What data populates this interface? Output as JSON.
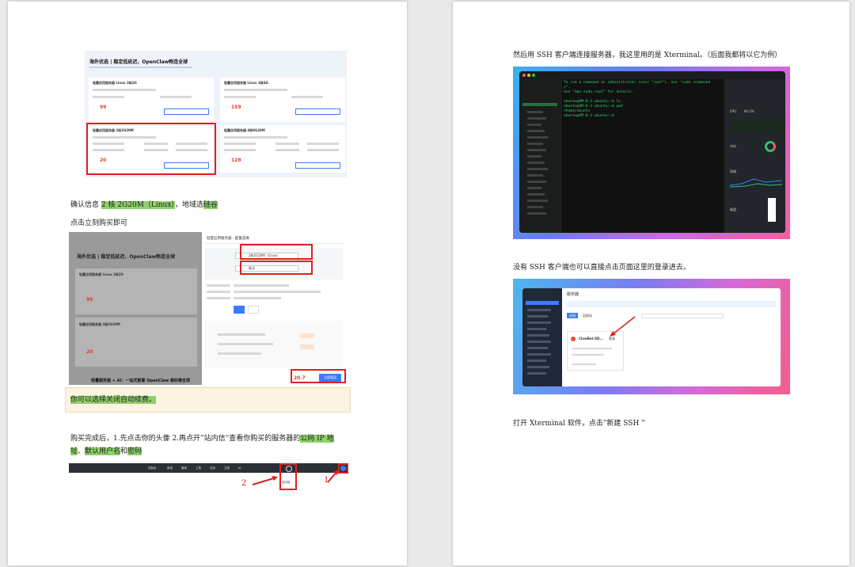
{
  "page1": {
    "shot1": {
      "title": "海外优选 | 稳定低延迟，OpenClaw畅连全球",
      "cards": [
        {
          "name": "轻量应用服务器 Linux 2核2G",
          "price": "99"
        },
        {
          "name": "轻量应用服务器 Linux 2核4G",
          "price": "159"
        },
        {
          "name": "轻量应用服务器 2核2G20M",
          "price": "20"
        },
        {
          "name": "轻量应用服务器 4核8G30M",
          "price": "128"
        }
      ],
      "buy_label": "立即购买"
    },
    "line1": {
      "pre": "确认信息 ",
      "hl1": "2 核 2G20M（Linux）",
      "mid": "，地域选",
      "hl2": "硅谷"
    },
    "line2": "点击立刻购买即可",
    "shot2": {
      "left_title": "海外优选 | 稳定低延迟，OpenClaw畅连全球",
      "card_a": "轻量应用服务器 Linux 2核2G",
      "card_b": "轻量应用服务器 2核2G20M",
      "price_a": "99",
      "price_b": "20",
      "bottom_text": "轻量服务器 + AI：一站式部署 OpenClaw 做好模全球",
      "panel_title": "轻量应用服务器 · 配置选择",
      "sel_os": "2核2G20M（Linux）",
      "sel_region": "硅谷",
      "total_price": "20.7",
      "buy_btn": "立即购买"
    },
    "note": "你可以选择关闭自动续费。",
    "line3": {
      "pre": "购买完成后，1.先点击你的头像 2.再点开”站内信“查看你购买的服务器的",
      "hl1": "公网 IP 地"
    },
    "line4": {
      "hl1": "址",
      "s1": "、",
      "hl2": "默认用户名",
      "s2": "和",
      "hl3": "密码"
    },
    "shot3": {
      "label_2": "2",
      "label_1": "1",
      "msg": "站内信",
      "menu": [
        "控制台",
        "费用",
        "备案",
        "工具",
        "支持",
        "文档",
        "AI"
      ]
    }
  },
  "page2": {
    "line1": "然后用 SSH 客户端连接服务器，我这里用的是 Xterminal。（后面我都将以它为例）",
    "terminal": {
      "lines": [
        "To run a command as administrator (user \"root\"), use \"sudo <command",
        ">\".",
        "See \"man sudo_root\" for details.",
        "",
        "ubuntu@VM-0-2-ubuntu:~$ ls",
        "ubuntu@VM-0-2-ubuntu:~$ pwd",
        "/home/ubuntu",
        "ubuntu@VM-0-2-ubuntu:~$ "
      ],
      "side_cpu": "CPU",
      "side_mem": "内存",
      "side_net": "网络",
      "side_disk": "磁盘",
      "cpu_val": "84.2%"
    },
    "line2": "没有 SSH 客户端也可以直接点击页面这里的登录进去。",
    "console": {
      "title": "服务器",
      "instance": "ClawBot-SD...",
      "login": "登录",
      "tab1": "实例",
      "tab2": "回收站"
    },
    "line3": "打开 Xterminal 软件，点击”新建 SSH ”"
  },
  "colors": {
    "highlight": "#8fd16a",
    "red": "#e02020",
    "accent": "#3b7cff"
  }
}
